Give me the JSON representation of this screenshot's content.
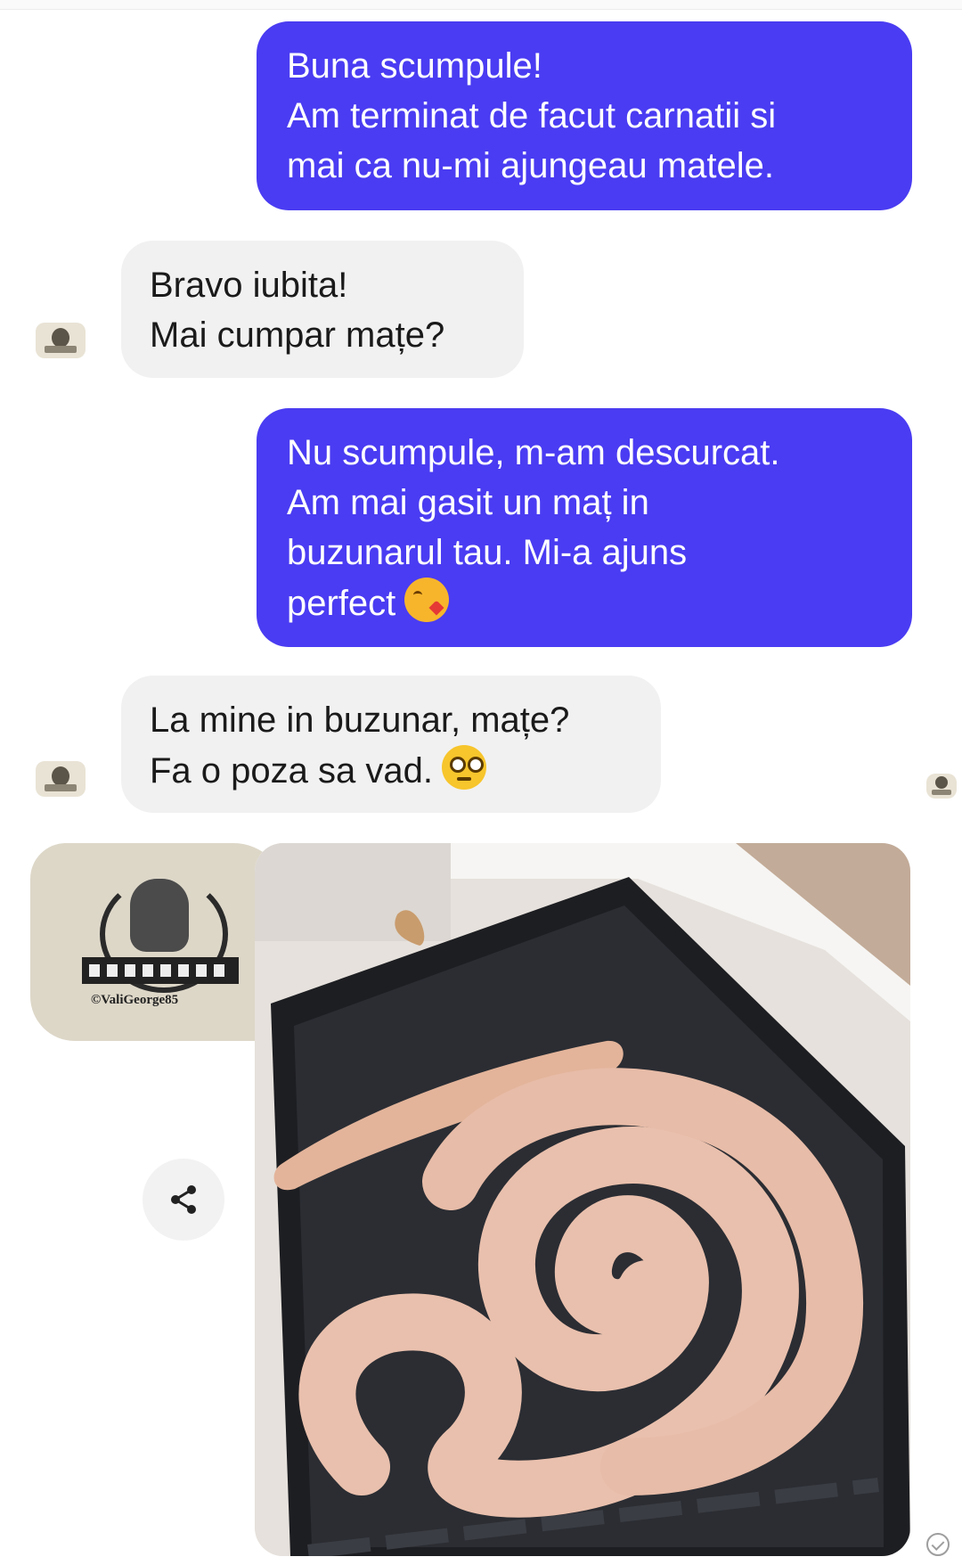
{
  "messages": [
    {
      "direction": "outgoing",
      "text": "Buna scumpule!\nAm terminat de facut carnatii si\nmai ca nu-mi ajungeau matele."
    },
    {
      "direction": "incoming",
      "text": "Bravo iubita!\nMai cumpar mațe?"
    },
    {
      "direction": "outgoing",
      "text": "Nu scumpule, m-am descurcat.\nAm mai gasit un maț in\nbuzunarul tau. Mi-a ajuns\nperfect",
      "emoji": "face-blowing-kiss"
    },
    {
      "direction": "incoming",
      "text": "La mine in buzunar, mațe?\nFa o poza sa vad.",
      "emoji": "flushed-face"
    }
  ],
  "watermark": {
    "text": "©ValiGeorge85"
  },
  "colors": {
    "outgoing_bubble": "#4a3cf2",
    "incoming_bubble": "#f1f1f1",
    "background": "#ffffff"
  },
  "icons": {
    "share": "share-icon",
    "seen": "check-circle-icon",
    "avatar": "contact-avatar"
  }
}
